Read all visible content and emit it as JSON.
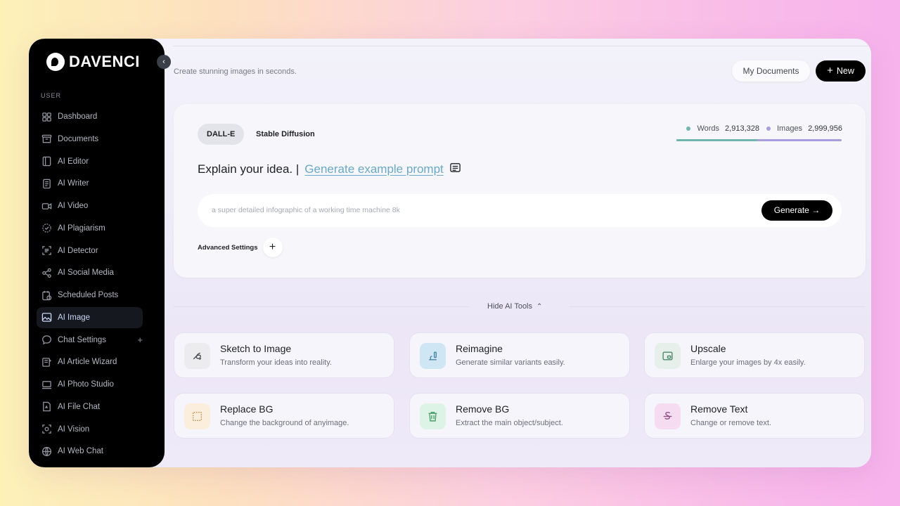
{
  "brand": {
    "name": "DAVENCI"
  },
  "sidebar": {
    "section_label": "USER",
    "items": [
      {
        "label": "Dashboard",
        "icon": "dashboard-icon"
      },
      {
        "label": "Documents",
        "icon": "archive-icon"
      },
      {
        "label": "AI Editor",
        "icon": "editor-icon"
      },
      {
        "label": "AI Writer",
        "icon": "writer-icon"
      },
      {
        "label": "AI Video",
        "icon": "video-icon"
      },
      {
        "label": "AI Plagiarism",
        "icon": "badge-check-icon"
      },
      {
        "label": "AI Detector",
        "icon": "scan-icon"
      },
      {
        "label": "AI Social Media",
        "icon": "share-icon"
      },
      {
        "label": "Scheduled Posts",
        "icon": "calendar-icon"
      },
      {
        "label": "AI Image",
        "icon": "image-icon",
        "active": true
      },
      {
        "label": "Chat Settings",
        "icon": "chat-icon"
      },
      {
        "label": "AI Article Wizard",
        "icon": "article-icon"
      },
      {
        "label": "AI Photo Studio",
        "icon": "monitor-icon"
      },
      {
        "label": "AI File Chat",
        "icon": "file-icon"
      },
      {
        "label": "AI Vision",
        "icon": "vision-icon"
      },
      {
        "label": "AI Web Chat",
        "icon": "globe-icon"
      }
    ],
    "chat_settings_plus": "+"
  },
  "header": {
    "subtitle": "Create stunning images in seconds.",
    "my_documents": "My Documents",
    "new_label": "New"
  },
  "generator": {
    "tabs": [
      "DALL-E",
      "Stable Diffusion"
    ],
    "stats": {
      "words_label": "Words",
      "words_value": "2,913,328",
      "images_label": "Images",
      "images_value": "2,999,956",
      "words_share": 0.49,
      "words_color": "#6fb6b2",
      "images_color": "#a99de0"
    },
    "title": "Explain your idea. |",
    "example_link": "Generate example prompt",
    "input_placeholder": "a super detailed infographic of a working time machine 8k",
    "generate_label": "Generate",
    "advanced_label": "Advanced Settings"
  },
  "tools_toggle": "Hide AI Tools",
  "tools": [
    {
      "title": "Sketch to Image",
      "desc": "Transform your ideas into reality.",
      "icon": "sketch-icon",
      "bg": "#ececef",
      "color": "#4a4d55"
    },
    {
      "title": "Reimagine",
      "desc": "Generate similar variants easily.",
      "icon": "reimagine-icon",
      "bg": "#cfe6f4",
      "color": "#4b86a8"
    },
    {
      "title": "Upscale",
      "desc": "Enlarge your images by 4x easily.",
      "icon": "upscale-icon",
      "bg": "#e6efe9",
      "color": "#4f8a6a"
    },
    {
      "title": "Replace BG",
      "desc": "Change the background of anyimage.",
      "icon": "replace-bg-icon",
      "bg": "#fbeedd",
      "color": "#c28a45"
    },
    {
      "title": "Remove BG",
      "desc": "Extract the main object/subject.",
      "icon": "trash-icon",
      "bg": "#ddf3e5",
      "color": "#4d9d6b"
    },
    {
      "title": "Remove Text",
      "desc": "Change or remove text.",
      "icon": "strikethrough-icon",
      "bg": "#f6dcf1",
      "color": "#8d4f85"
    }
  ]
}
